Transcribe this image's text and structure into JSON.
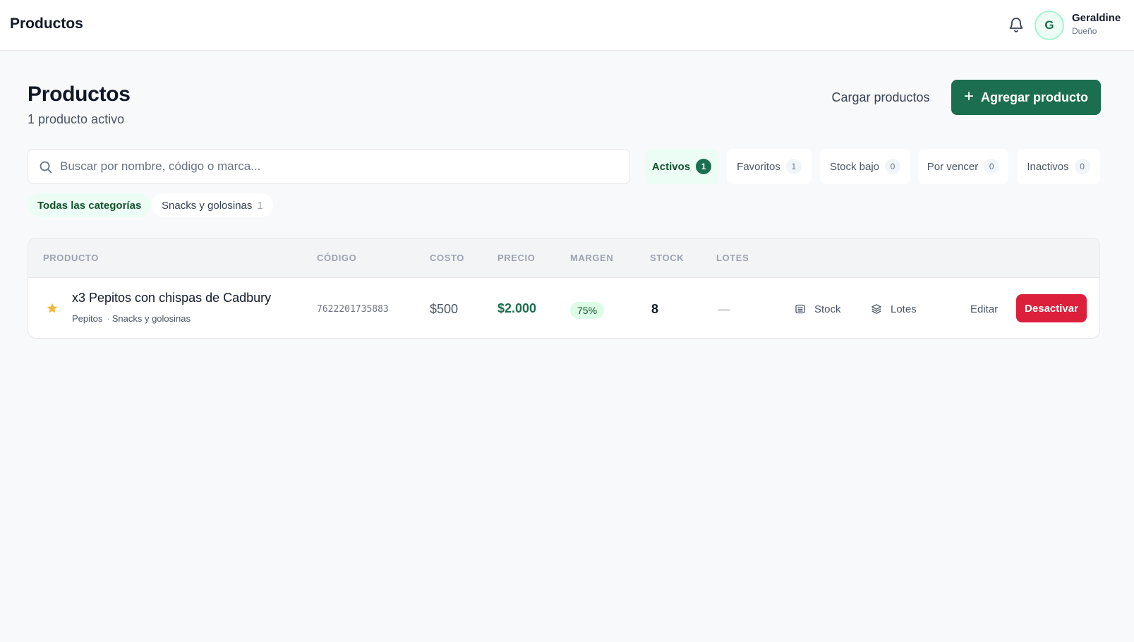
{
  "header": {
    "title": "Productos",
    "user": {
      "initial": "G",
      "name": "Geraldine",
      "role": "Dueño"
    }
  },
  "page": {
    "title": "Productos",
    "subtitle": "1 producto activo",
    "load_label": "Cargar productos",
    "add_label": "Agregar producto"
  },
  "search": {
    "placeholder": "Buscar por nombre, código o marca...",
    "value": ""
  },
  "filters": [
    {
      "label": "Activos",
      "count": "1",
      "active": true
    },
    {
      "label": "Favoritos",
      "count": "1"
    },
    {
      "label": "Stock bajo",
      "count": "0"
    },
    {
      "label": "Por vencer",
      "count": "0"
    },
    {
      "label": "Inactivos",
      "count": "0"
    }
  ],
  "categories": {
    "all_label": "Todas las categorías",
    "items": [
      {
        "label": "Snacks y golosinas",
        "count": "1"
      }
    ]
  },
  "table": {
    "columns": [
      "PRODUCTO",
      "CÓDIGO",
      "COSTO",
      "PRECIO",
      "MARGEN",
      "STOCK",
      "LOTES"
    ],
    "rows": [
      {
        "name": "x3 Pepitos con chispas de Cadbury",
        "brand": "Pepitos",
        "separator": "·",
        "category": "Snacks y golosinas",
        "code": "7622201735883",
        "cost": "$500",
        "price": "$2.000",
        "margin": "75%",
        "stock": "8",
        "lots": "—",
        "actions": {
          "stock": "Stock",
          "lots": "Lotes",
          "edit": "Editar",
          "deactivate": "Desactivar"
        }
      }
    ]
  },
  "colors": {
    "accent": "#1b6e4f",
    "danger": "#dc1f3a",
    "star": "#f5b942"
  }
}
